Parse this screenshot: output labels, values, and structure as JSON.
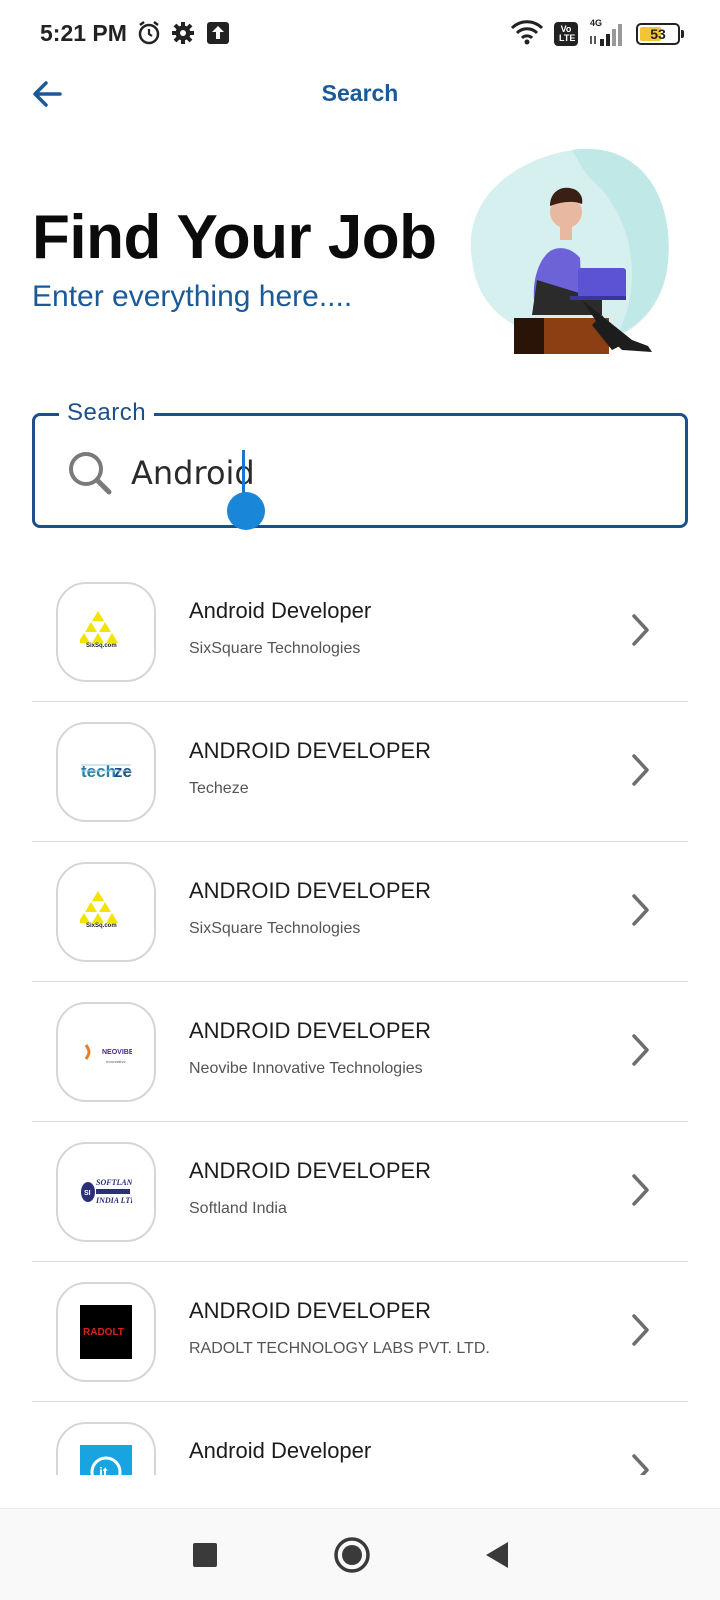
{
  "status_bar": {
    "time": "5:21 PM",
    "icons": [
      "alarm-icon",
      "gear-icon",
      "upload-icon",
      "wifi-icon",
      "volte-icon",
      "signal-icon",
      "battery-icon"
    ],
    "volte_top": "Vo",
    "volte_bottom": "LTE",
    "network": "4G",
    "battery_level": "53"
  },
  "app_bar": {
    "title": "Search",
    "back_icon": "arrow-left-icon"
  },
  "hero": {
    "title": "Find Your Job",
    "subtitle": "Enter everything here...."
  },
  "search": {
    "label": "Search",
    "value": "Android",
    "icon": "search-icon"
  },
  "jobs": [
    {
      "title": "Android Developer",
      "company": "SixSquare Technologies",
      "logo_text": "SixSquare"
    },
    {
      "title": "ANDROID DEVELOPER",
      "company": "Techeze",
      "logo_text": "techeze"
    },
    {
      "title": "ANDROID DEVELOPER",
      "company": "SixSquare Technologies",
      "logo_text": "SixSquare"
    },
    {
      "title": "ANDROID DEVELOPER",
      "company": "Neovibe Innovative Technologies",
      "logo_text": "NEOVIBE"
    },
    {
      "title": "ANDROID DEVELOPER",
      "company": "Softland India",
      "logo_text": "SOFTLAND INDIA LTD"
    },
    {
      "title": "ANDROID DEVELOPER",
      "company": "RADOLT TECHNOLOGY LABS PVT. LTD.",
      "logo_text": "RADOLT"
    },
    {
      "title": "Android Developer",
      "company": "",
      "logo_text": "it"
    }
  ],
  "colors": {
    "primary": "#1b5a99",
    "outline": "#1d4f8b",
    "caret": "#1a86d8",
    "heading": "#0b0b0b"
  },
  "nav_bar": {
    "icons": [
      "recents-square-icon",
      "home-circle-icon",
      "back-triangle-icon"
    ]
  }
}
